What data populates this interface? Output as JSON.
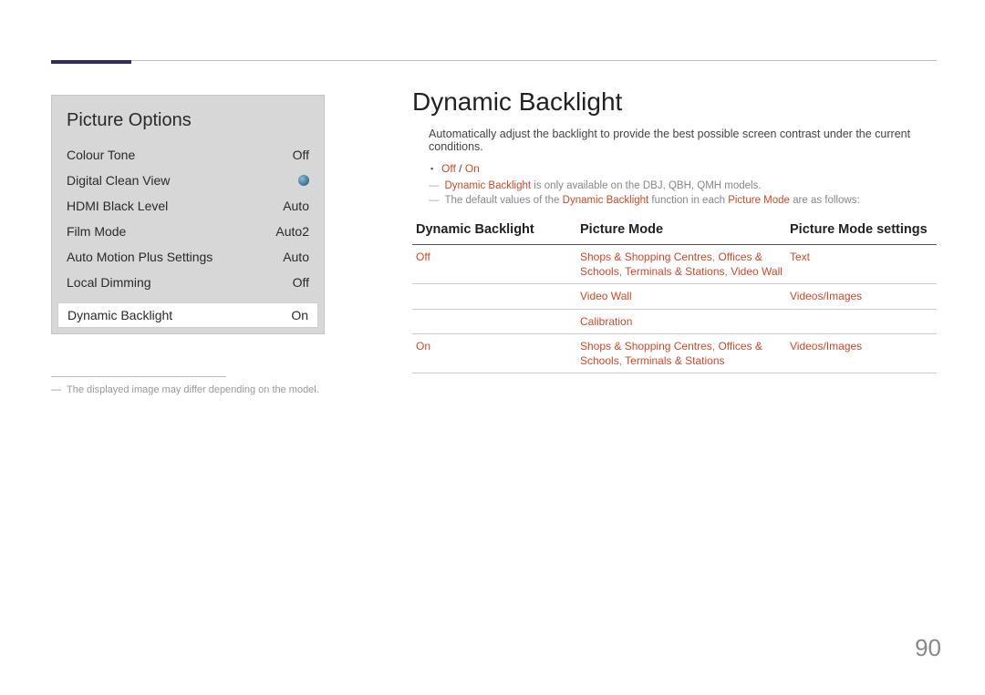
{
  "panel": {
    "title": "Picture Options",
    "rows": [
      {
        "label": "Colour Tone",
        "value": "Off"
      },
      {
        "label": "Digital Clean View",
        "value": ""
      },
      {
        "label": "HDMI Black Level",
        "value": "Auto"
      },
      {
        "label": "Film Mode",
        "value": "Auto2"
      },
      {
        "label": "Auto Motion Plus Settings",
        "value": "Auto"
      },
      {
        "label": "Local Dimming",
        "value": "Off"
      }
    ],
    "selected": {
      "label": "Dynamic Backlight",
      "value": "On"
    }
  },
  "caption_dash": "―",
  "caption": "The displayed image may differ depending on the model.",
  "main": {
    "title": "Dynamic Backlight",
    "description": "Automatically adjust the backlight to provide the best possible screen contrast under the current conditions.",
    "bullet_off": "Off",
    "bullet_sep": " / ",
    "bullet_on": "On",
    "note1_pre": "Dynamic Backlight",
    "note1_post": " is only available on the DBJ, QBH, QMH models.",
    "note2_a": "The default values of the ",
    "note2_b": "Dynamic Backlight",
    "note2_c": " function in each ",
    "note2_d": "Picture Mode",
    "note2_e": " are as follows:"
  },
  "table": {
    "h1": "Dynamic Backlight",
    "h2": "Picture Mode",
    "h3": "Picture Mode settings",
    "rows": [
      {
        "c1": "Off",
        "c2_parts": [
          "Shops & Shopping Centres",
          ", ",
          "Offices & Schools",
          ", ",
          "Terminals & Stations",
          ", ",
          "Video Wall"
        ],
        "c3": "Text"
      },
      {
        "c1": "",
        "c2_parts": [
          "Video Wall"
        ],
        "c3": "Videos/Images"
      },
      {
        "c1": "",
        "c2_parts": [
          "Calibration"
        ],
        "c3": ""
      },
      {
        "c1": "On",
        "c2_parts": [
          "Shops & Shopping Centres",
          ", ",
          "Offices & Schools",
          ", ",
          "Terminals & Stations"
        ],
        "c3": "Videos/Images"
      }
    ]
  },
  "page_number": "90"
}
